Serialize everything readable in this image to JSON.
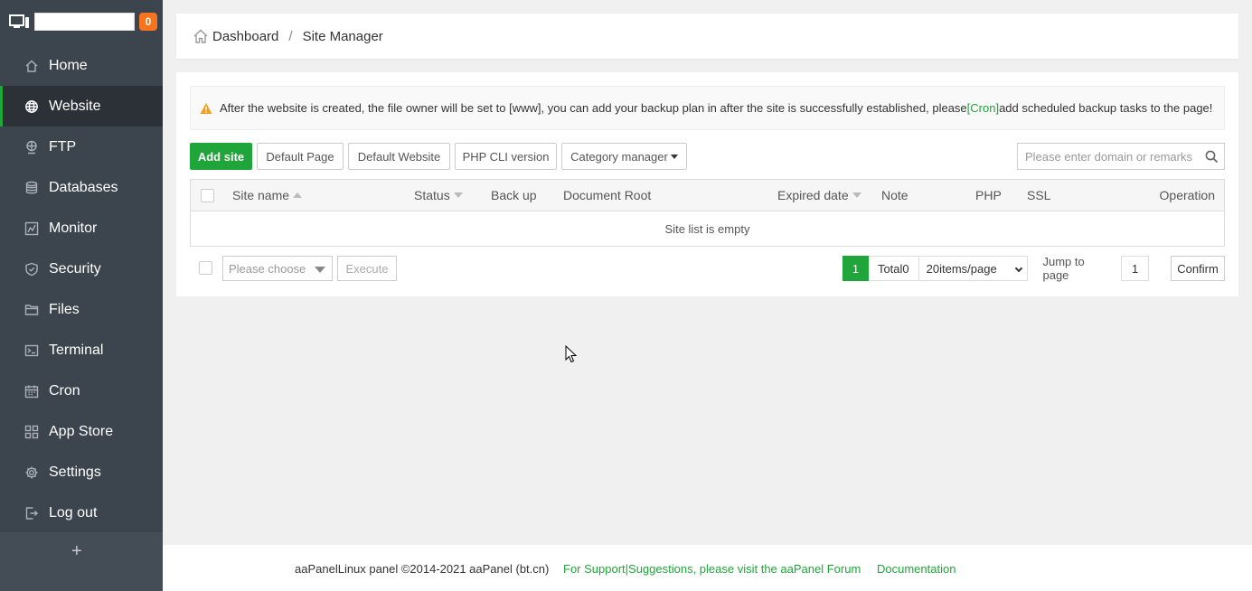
{
  "sidebar": {
    "badge_count": "0",
    "items": [
      {
        "label": "Home",
        "icon": "home-icon"
      },
      {
        "label": "Website",
        "icon": "globe-icon",
        "active": true
      },
      {
        "label": "FTP",
        "icon": "ftp-icon"
      },
      {
        "label": "Databases",
        "icon": "database-icon"
      },
      {
        "label": "Monitor",
        "icon": "monitor-chart-icon"
      },
      {
        "label": "Security",
        "icon": "shield-icon"
      },
      {
        "label": "Files",
        "icon": "folder-icon"
      },
      {
        "label": "Terminal",
        "icon": "terminal-icon"
      },
      {
        "label": "Cron",
        "icon": "calendar-icon"
      },
      {
        "label": "App Store",
        "icon": "grid-icon"
      },
      {
        "label": "Settings",
        "icon": "gear-icon"
      },
      {
        "label": "Log out",
        "icon": "logout-icon"
      }
    ],
    "add_label": "+"
  },
  "breadcrumb": {
    "home": "Dashboard",
    "separator": "/",
    "current": "Site Manager"
  },
  "notice": {
    "text_before": "After the website is created, the file owner will be set to [www], you can add your backup plan in after the site is successfully established, please",
    "link": "[Cron]",
    "text_after": "add scheduled backup tasks to the page!"
  },
  "toolbar": {
    "add_site": "Add site",
    "default_page": "Default Page",
    "default_website": "Default Website",
    "php_cli": "PHP CLI version",
    "category_manager": "Category manager"
  },
  "search": {
    "placeholder": "Please enter domain or remarks"
  },
  "table": {
    "columns": {
      "site_name": "Site name",
      "status": "Status",
      "backup": "Back up",
      "document_root": "Document Root",
      "expired_date": "Expired date",
      "note": "Note",
      "php": "PHP",
      "ssl": "SSL",
      "operation": "Operation"
    },
    "empty_text": "Site list is empty"
  },
  "batch": {
    "select_placeholder": "Please choose",
    "execute": "Execute"
  },
  "pagination": {
    "current_page": "1",
    "total": "Total0",
    "page_size": "20items/page",
    "jump_label": "Jump to page",
    "jump_value": "1",
    "confirm": "Confirm"
  },
  "footer": {
    "copyright": "aaPanelLinux panel ©2014-2021 aaPanel (bt.cn)",
    "support_link": "For Support|Suggestions, please visit the aaPanel Forum",
    "docs_link": "Documentation"
  },
  "colors": {
    "accent": "#20a53a",
    "sidebar_bg": "#3c444d",
    "badge": "#f7731c"
  }
}
